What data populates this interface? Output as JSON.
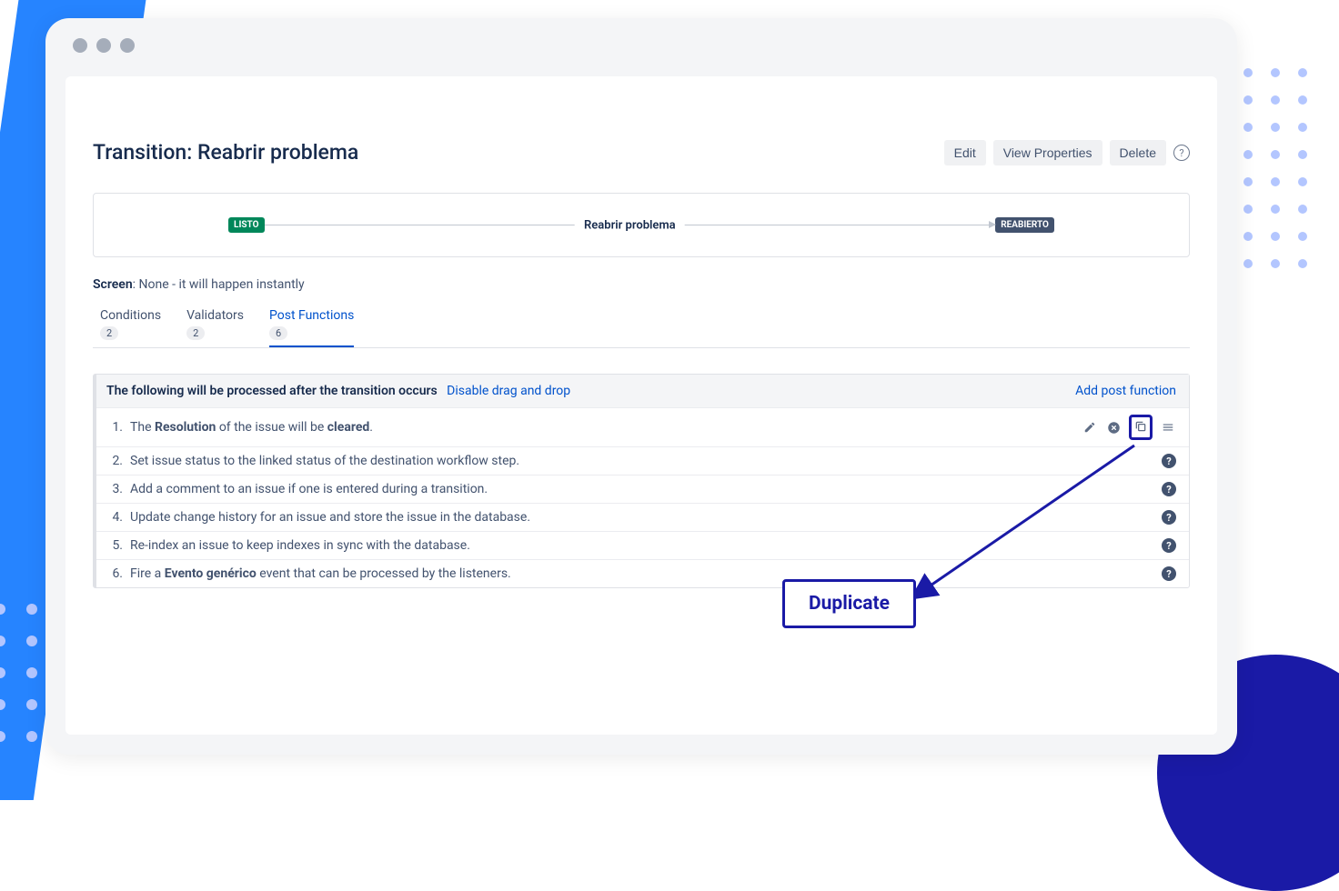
{
  "header": {
    "title": "Transition: Reabrir problema",
    "edit": "Edit",
    "view_properties": "View Properties",
    "delete": "Delete"
  },
  "flow": {
    "from_status": "LISTO",
    "transition_name": "Reabrir problema",
    "to_status": "REABIERTO"
  },
  "screen_line": {
    "label": "Screen",
    "value": ": None - it will happen instantly"
  },
  "tabs": {
    "conditions": {
      "label": "Conditions",
      "count": "2"
    },
    "validators": {
      "label": "Validators",
      "count": "2"
    },
    "post_functions": {
      "label": "Post Functions",
      "count": "6"
    }
  },
  "panel": {
    "header_text": "The following will be processed after the transition occurs",
    "disable_drag": "Disable drag and drop",
    "add_link": "Add post function"
  },
  "funcs": {
    "f1_a": "The ",
    "f1_b": "Resolution",
    "f1_c": " of the issue will be ",
    "f1_d": "cleared",
    "f1_e": ".",
    "f2": "Set issue status to the linked status of the destination workflow step.",
    "f3": "Add a comment to an issue if one is entered during a transition.",
    "f4": "Update change history for an issue and store the issue in the database.",
    "f5": "Re-index an issue to keep indexes in sync with the database.",
    "f6_a": "Fire a ",
    "f6_b": "Evento genérico",
    "f6_c": " event that can be processed by the listeners."
  },
  "nums": {
    "n1": "1.",
    "n2": "2.",
    "n3": "3.",
    "n4": "4.",
    "n5": "5.",
    "n6": "6."
  },
  "annotation": {
    "label": "Duplicate"
  }
}
